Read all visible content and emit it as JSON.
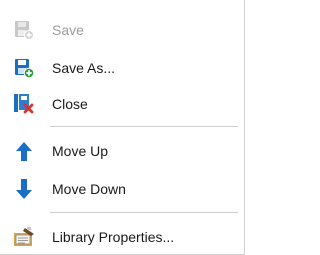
{
  "menu": {
    "items": [
      {
        "label": "Save",
        "icon": "save-icon",
        "enabled": false
      },
      {
        "label": "Save As...",
        "icon": "save-as-icon",
        "enabled": true
      },
      {
        "label": "Close",
        "icon": "close-library-icon",
        "enabled": true
      },
      {
        "label": "Move Up",
        "icon": "arrow-up-icon",
        "enabled": true
      },
      {
        "label": "Move Down",
        "icon": "arrow-down-icon",
        "enabled": true
      },
      {
        "label": "Library Properties...",
        "icon": "library-properties-icon",
        "enabled": true
      }
    ]
  },
  "colors": {
    "accent_blue": "#1a6fc4",
    "close_red": "#d8322e",
    "add_green": "#2e9a3a",
    "disabled_text": "#9c9c9c",
    "separator": "#cfcfcf"
  }
}
